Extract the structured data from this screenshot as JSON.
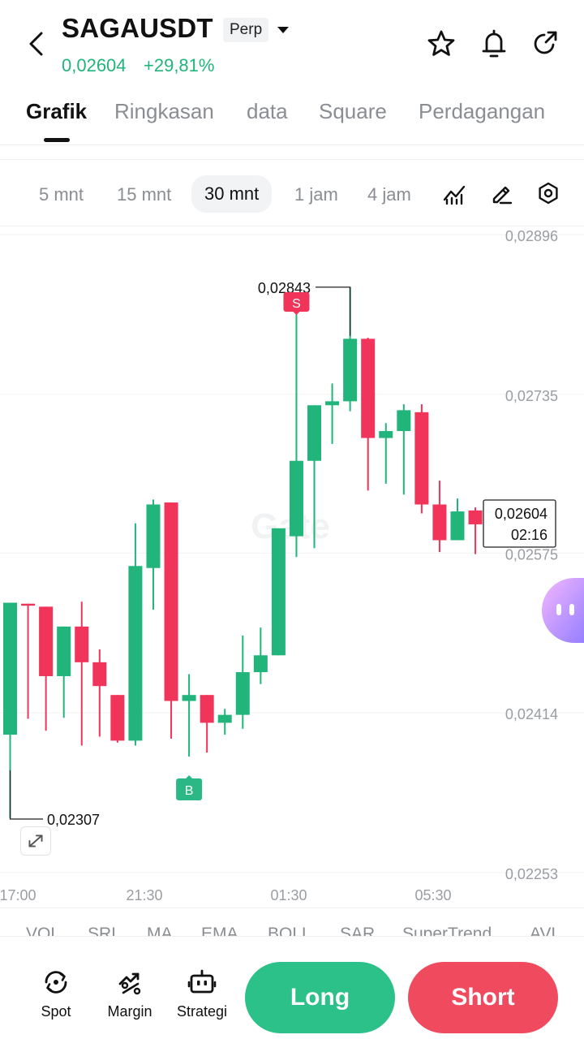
{
  "header": {
    "symbol": "SAGAUSDT",
    "contract_type": "Perp",
    "last_price": "0,02604",
    "change_pct": "+29,81%",
    "icons": [
      "back-arrow-icon",
      "caret-down-icon",
      "star-icon",
      "bell-icon",
      "share-icon"
    ]
  },
  "tabs": [
    {
      "label": "Grafik",
      "active": true
    },
    {
      "label": "Ringkasan"
    },
    {
      "label": "data"
    },
    {
      "label": "Square"
    },
    {
      "label": "Perdagangan"
    }
  ],
  "intervals": [
    {
      "label": "5 mnt"
    },
    {
      "label": "15 mnt"
    },
    {
      "label": "30 mnt",
      "active": true
    },
    {
      "label": "1 jam"
    },
    {
      "label": "4 jam"
    }
  ],
  "chart_tools": [
    "indicator-icon",
    "draw-icon",
    "settings-icon"
  ],
  "chart_data": {
    "type": "candlestick",
    "interval": "30 mnt",
    "up_color": "#21b47b",
    "down_color": "#f0345a",
    "x_tick_labels": [
      "17:00",
      "21:30",
      "01:30",
      "05:30"
    ],
    "y_tick_labels": [
      "0,02896",
      "0,02735",
      "0,02575",
      "0,02414",
      "0,02253"
    ],
    "ylim": [
      0.02253,
      0.02896
    ],
    "high_marker": "0,02843",
    "low_marker": "0,02307",
    "current_price_label": "0,02604",
    "countdown": "02:16",
    "sell_marker": "S",
    "buy_marker": "B",
    "watermark": "Gate",
    "candles": [
      {
        "o": 0.02392,
        "h": 0.02486,
        "l": 0.02308,
        "c": 0.02525
      },
      {
        "o": 0.02524,
        "h": 0.02524,
        "l": 0.02408,
        "c": 0.02522
      },
      {
        "o": 0.02521,
        "h": 0.02521,
        "l": 0.02396,
        "c": 0.02451
      },
      {
        "o": 0.02451,
        "h": 0.02496,
        "l": 0.02409,
        "c": 0.02501
      },
      {
        "o": 0.02501,
        "h": 0.02526,
        "l": 0.02381,
        "c": 0.02465
      },
      {
        "o": 0.02465,
        "h": 0.02478,
        "l": 0.0239,
        "c": 0.02441
      },
      {
        "o": 0.02432,
        "h": 0.02432,
        "l": 0.02384,
        "c": 0.02386
      },
      {
        "o": 0.02386,
        "h": 0.02605,
        "l": 0.02381,
        "c": 0.02562
      },
      {
        "o": 0.0256,
        "h": 0.02629,
        "l": 0.02518,
        "c": 0.02624
      },
      {
        "o": 0.02626,
        "h": 0.02624,
        "l": 0.02388,
        "c": 0.02426
      },
      {
        "o": 0.02426,
        "h": 0.02453,
        "l": 0.0237,
        "c": 0.02432
      },
      {
        "o": 0.02432,
        "h": 0.02432,
        "l": 0.02374,
        "c": 0.02404
      },
      {
        "o": 0.02404,
        "h": 0.02418,
        "l": 0.02392,
        "c": 0.02412
      },
      {
        "o": 0.02412,
        "h": 0.02492,
        "l": 0.02398,
        "c": 0.02455
      },
      {
        "o": 0.02455,
        "h": 0.025,
        "l": 0.02443,
        "c": 0.02472
      },
      {
        "o": 0.02472,
        "h": 0.0253,
        "l": 0.02472,
        "c": 0.026
      },
      {
        "o": 0.02592,
        "h": 0.02829,
        "l": 0.02571,
        "c": 0.02668
      },
      {
        "o": 0.02668,
        "h": 0.02714,
        "l": 0.0258,
        "c": 0.02724
      },
      {
        "o": 0.02724,
        "h": 0.02746,
        "l": 0.02685,
        "c": 0.02728
      },
      {
        "o": 0.02728,
        "h": 0.02843,
        "l": 0.02718,
        "c": 0.02791
      },
      {
        "o": 0.02791,
        "h": 0.02792,
        "l": 0.02638,
        "c": 0.02691
      },
      {
        "o": 0.02691,
        "h": 0.02706,
        "l": 0.02645,
        "c": 0.02698
      },
      {
        "o": 0.02698,
        "h": 0.02725,
        "l": 0.02634,
        "c": 0.02719
      },
      {
        "o": 0.02717,
        "h": 0.02725,
        "l": 0.02615,
        "c": 0.02624
      },
      {
        "o": 0.02624,
        "h": 0.02648,
        "l": 0.02576,
        "c": 0.02588
      },
      {
        "o": 0.02588,
        "h": 0.0263,
        "l": 0.02588,
        "c": 0.02617
      },
      {
        "o": 0.02618,
        "h": 0.02621,
        "l": 0.02574,
        "c": 0.02604
      }
    ]
  },
  "indicators": [
    "VOL",
    "SRI",
    "MA",
    "EMA",
    "BOLL",
    "SAR",
    "SuperTrend",
    "AVL"
  ],
  "bottom_nav": [
    {
      "label": "Spot",
      "icon": "spot-icon"
    },
    {
      "label": "Margin",
      "icon": "margin-icon"
    },
    {
      "label": "Strategi",
      "icon": "strategy-bot-icon"
    }
  ],
  "actions": {
    "long_label": "Long",
    "short_label": "Short"
  }
}
